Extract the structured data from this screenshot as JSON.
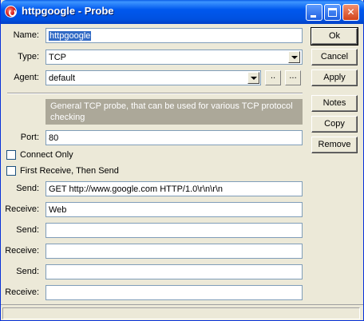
{
  "window": {
    "title": "httpgoogle - Probe"
  },
  "titlebar": {
    "minimize": "",
    "maximize": "",
    "close": "✕"
  },
  "form": {
    "name_label": "Name:",
    "name_value": "httpgoogle",
    "type_label": "Type:",
    "type_value": "TCP",
    "agent_label": "Agent:",
    "agent_value": "default",
    "agent_btn1": "..",
    "agent_btn2": "...",
    "description": "General TCP probe, that can be used for various TCP protocol checking",
    "port_label": "Port:",
    "port_value": "80",
    "connect_only_label": "Connect Only",
    "first_receive_label": "First Receive, Then Send",
    "send1_label": "Send:",
    "send1_value": "GET http://www.google.com HTTP/1.0\\r\\n\\r\\n",
    "receive1_label": "Receive:",
    "receive1_value": "Web",
    "send2_label": "Send:",
    "send2_value": "",
    "receive2_label": "Receive:",
    "receive2_value": "",
    "send3_label": "Send:",
    "send3_value": "",
    "receive3_label": "Receive:",
    "receive3_value": ""
  },
  "buttons": {
    "ok": "Ok",
    "cancel": "Cancel",
    "apply": "Apply",
    "notes": "Notes",
    "copy": "Copy",
    "remove": "Remove"
  },
  "colors": {
    "titlebar": "#0058ee",
    "face": "#ece9d8",
    "selection": "#316ac5",
    "description_bg": "#aca899"
  }
}
